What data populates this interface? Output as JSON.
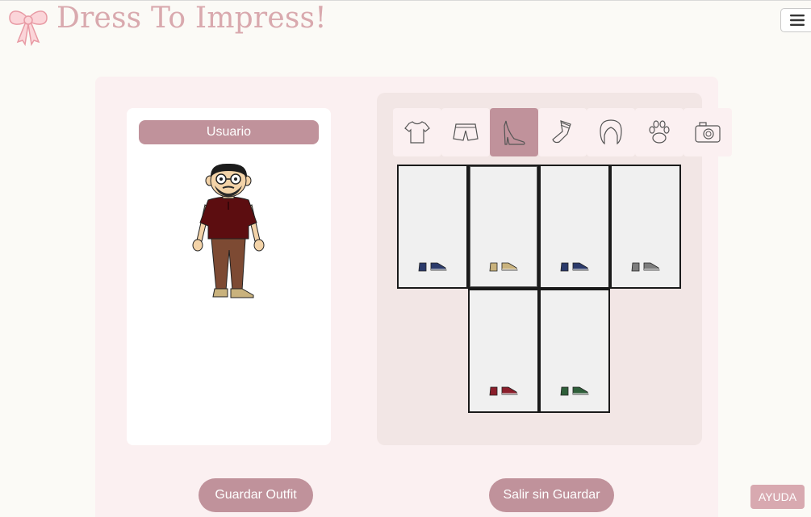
{
  "header": {
    "brand_title": "Dress To Impress!",
    "logo_icon": "bow-icon",
    "menu_icon": "hamburger-menu-icon"
  },
  "user_card": {
    "username": "Usuario"
  },
  "categories": [
    {
      "icon": "tshirt-icon",
      "active": false
    },
    {
      "icon": "shorts-icon",
      "active": false
    },
    {
      "icon": "high-heel-icon",
      "active": true
    },
    {
      "icon": "socks-icon",
      "active": false
    },
    {
      "icon": "hair-icon",
      "active": false
    },
    {
      "icon": "paw-icon",
      "active": false
    },
    {
      "icon": "camera-icon",
      "active": false
    }
  ],
  "shoes": [
    {
      "color": "#2b3a6b",
      "selected": false
    },
    {
      "color": "#c9b27d",
      "selected": true
    },
    {
      "color": "#2b3a6b",
      "selected": false
    },
    {
      "color": "#7d7d7d",
      "selected": false
    },
    {
      "color": "#8b1e2b",
      "selected": false
    },
    {
      "color": "#2f5f3a",
      "selected": false
    }
  ],
  "actions": {
    "save_label": "Guardar Outfit",
    "exit_label": "Salir sin Guardar"
  },
  "help_label": "AYUDA",
  "colors": {
    "accent": "#c0929b",
    "brand": "#d9a9ae",
    "panel": "#fbf0f1",
    "wardrobe_bg": "#f2e6e5"
  }
}
